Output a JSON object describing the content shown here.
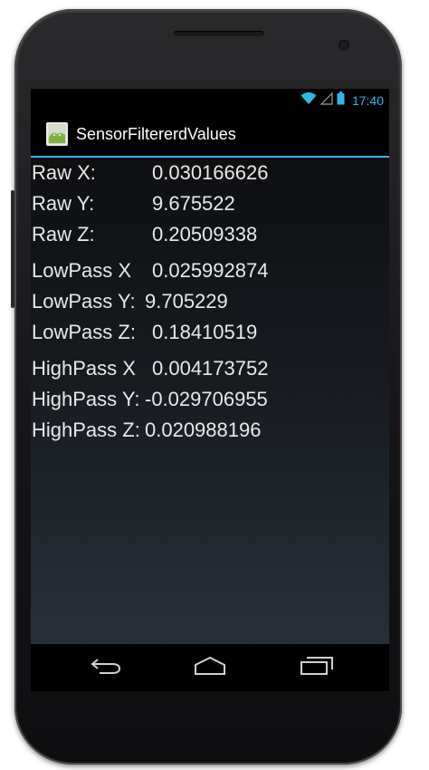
{
  "status_bar": {
    "time": "17:40",
    "icons": [
      "wifi-icon",
      "signal-icon",
      "battery-icon"
    ]
  },
  "action_bar": {
    "app_icon": "android-app-icon",
    "title": "SensorFiltererdValues"
  },
  "readings": {
    "raw": [
      {
        "label": "Raw X:",
        "value": "0.030166626"
      },
      {
        "label": "Raw Y:",
        "value": "9.675522"
      },
      {
        "label": "Raw Z:",
        "value": "0.20509338"
      }
    ],
    "lowpass": [
      {
        "label": "LowPass X",
        "value": "0.025992874"
      },
      {
        "label": "LowPass Y:",
        "value": "9.705229"
      },
      {
        "label": "LowPass Z:",
        "value": "0.18410519"
      }
    ],
    "highpass": [
      {
        "label": "HighPass X",
        "value": "0.004173752"
      },
      {
        "label": "HighPass Y:",
        "value": "-0.029706955"
      },
      {
        "label": "HighPass Z:",
        "value": "0.020988196"
      }
    ]
  },
  "nav_bar": {
    "buttons": [
      "back-icon",
      "home-icon",
      "recent-apps-icon"
    ]
  },
  "colors": {
    "accent": "#33b5e5",
    "text": "#e8e8e8"
  }
}
